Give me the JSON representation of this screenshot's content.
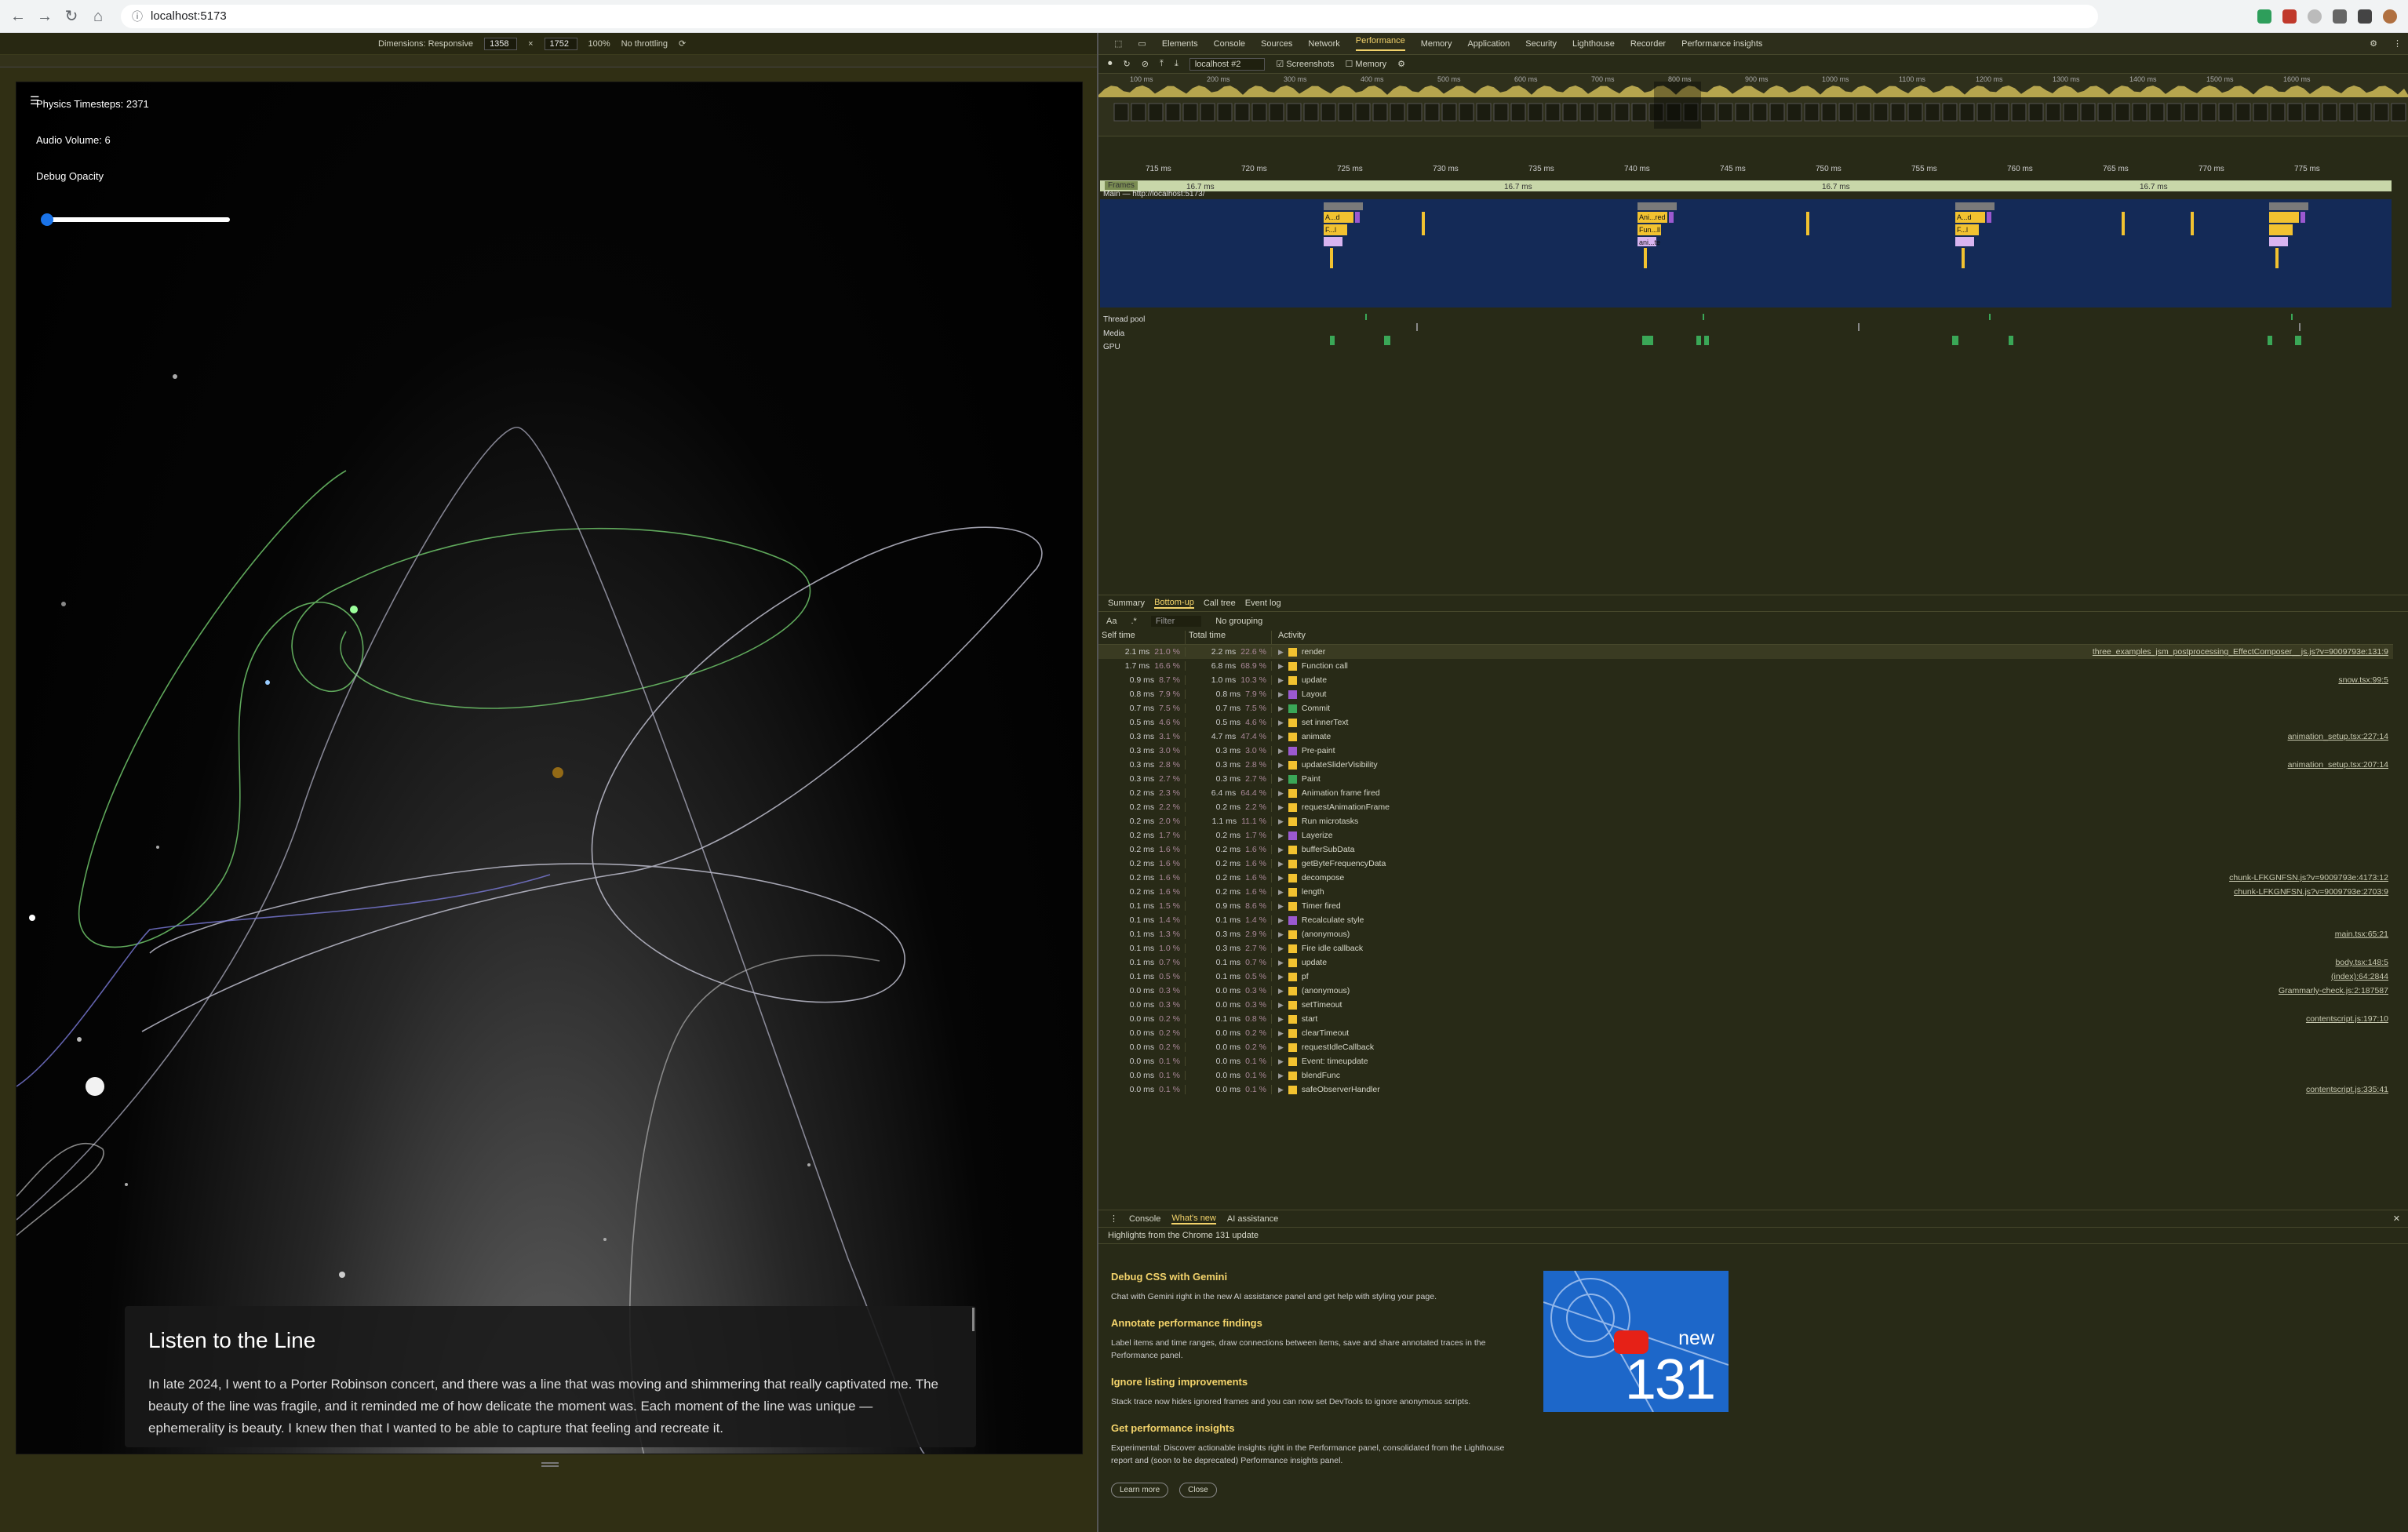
{
  "browser": {
    "url": "localhost:5173"
  },
  "emulation": {
    "dimensions_label": "Dimensions: Responsive",
    "width": "1358",
    "height": "1752",
    "zoom": "100%",
    "throttling": "No throttling"
  },
  "app": {
    "physics_timesteps": "Physics Timesteps: 2371",
    "audio_volume": "Audio Volume: 6",
    "debug_opacity_label": "Debug Opacity",
    "debug_opacity_value": 0.02,
    "card_title": "Listen to the Line",
    "card_text": "In late 2024, I went to a Porter Robinson concert, and there was a line that was moving and shimmering that really captivated me. The beauty of the line was fragile, and it reminded me of how delicate the moment was. Each moment of the line was unique — ephemerality is beauty. I knew then that I wanted to be able to capture that feeling and recreate it."
  },
  "devtools": {
    "tabs": [
      "Elements",
      "Console",
      "Sources",
      "Network",
      "Performance",
      "Memory",
      "Application",
      "Security",
      "Lighthouse",
      "Recorder",
      "Performance insights"
    ],
    "active_tab": "Performance",
    "recording_select": "localhost #2",
    "screenshots_label": "Screenshots",
    "memory_label": "Memory",
    "overview_ticks": [
      "100 ms",
      "200 ms",
      "300 ms",
      "400 ms",
      "500 ms",
      "600 ms",
      "700 ms",
      "800 ms",
      "900 ms",
      "1000 ms",
      "1100 ms",
      "1200 ms",
      "1300 ms",
      "1400 ms",
      "1500 ms",
      "1600 ms"
    ],
    "time_ticks": [
      "715 ms",
      "720 ms",
      "725 ms",
      "730 ms",
      "735 ms",
      "740 ms",
      "745 ms",
      "750 ms",
      "755 ms",
      "760 ms",
      "765 ms",
      "770 ms",
      "775 ms"
    ],
    "frames_label": "Frames",
    "frame_times": [
      "16.7 ms",
      "16.7 ms",
      "16.7 ms",
      "16.7 ms",
      "16.7 ms"
    ],
    "main_label": "Main — http://localhost:5173/",
    "flame_labels": [
      "A...d",
      "F...l",
      "Ani...red",
      "Fun...ll",
      "ani...te",
      "A...d",
      "F...l"
    ],
    "thread_pool_label": "Thread pool",
    "media_label": "Media",
    "gpu_label": "GPU",
    "sub_tabs": [
      "Summary",
      "Bottom-up",
      "Call tree",
      "Event log"
    ],
    "active_sub_tab": "Bottom-up",
    "filter_placeholder": "Filter",
    "grouping": "No grouping",
    "col_self": "Self time",
    "col_total": "Total time",
    "col_activity": "Activity",
    "rows": [
      {
        "self": "2.1 ms",
        "self_pct": "21.0 %",
        "total": "2.2 ms",
        "total_pct": "22.6 %",
        "name": "render",
        "color": "#f2c230",
        "link": "three_examples_jsm_postprocessing_EffectComposer__js.js?v=9009793e:131:9"
      },
      {
        "self": "1.7 ms",
        "self_pct": "16.6 %",
        "total": "6.8 ms",
        "total_pct": "68.9 %",
        "name": "Function call",
        "color": "#f2c230",
        "link": ""
      },
      {
        "self": "0.9 ms",
        "self_pct": "8.7 %",
        "total": "1.0 ms",
        "total_pct": "10.3 %",
        "name": "update",
        "color": "#f2c230",
        "link": "snow.tsx:99:5"
      },
      {
        "self": "0.8 ms",
        "self_pct": "7.9 %",
        "total": "0.8 ms",
        "total_pct": "7.9 %",
        "name": "Layout",
        "color": "#9b59d0",
        "link": ""
      },
      {
        "self": "0.7 ms",
        "self_pct": "7.5 %",
        "total": "0.7 ms",
        "total_pct": "7.5 %",
        "name": "Commit",
        "color": "#3aa757",
        "link": ""
      },
      {
        "self": "0.5 ms",
        "self_pct": "4.6 %",
        "total": "0.5 ms",
        "total_pct": "4.6 %",
        "name": "set innerText",
        "color": "#f2c230",
        "link": ""
      },
      {
        "self": "0.3 ms",
        "self_pct": "3.1 %",
        "total": "4.7 ms",
        "total_pct": "47.4 %",
        "name": "animate",
        "color": "#f2c230",
        "link": "animation_setup.tsx:227:14"
      },
      {
        "self": "0.3 ms",
        "self_pct": "3.0 %",
        "total": "0.3 ms",
        "total_pct": "3.0 %",
        "name": "Pre-paint",
        "color": "#9b59d0",
        "link": ""
      },
      {
        "self": "0.3 ms",
        "self_pct": "2.8 %",
        "total": "0.3 ms",
        "total_pct": "2.8 %",
        "name": "updateSliderVisibility",
        "color": "#f2c230",
        "link": "animation_setup.tsx:207:14"
      },
      {
        "self": "0.3 ms",
        "self_pct": "2.7 %",
        "total": "0.3 ms",
        "total_pct": "2.7 %",
        "name": "Paint",
        "color": "#3aa757",
        "link": ""
      },
      {
        "self": "0.2 ms",
        "self_pct": "2.3 %",
        "total": "6.4 ms",
        "total_pct": "64.4 %",
        "name": "Animation frame fired",
        "color": "#f2c230",
        "link": ""
      },
      {
        "self": "0.2 ms",
        "self_pct": "2.2 %",
        "total": "0.2 ms",
        "total_pct": "2.2 %",
        "name": "requestAnimationFrame",
        "color": "#f2c230",
        "link": ""
      },
      {
        "self": "0.2 ms",
        "self_pct": "2.0 %",
        "total": "1.1 ms",
        "total_pct": "11.1 %",
        "name": "Run microtasks",
        "color": "#f2c230",
        "link": ""
      },
      {
        "self": "0.2 ms",
        "self_pct": "1.7 %",
        "total": "0.2 ms",
        "total_pct": "1.7 %",
        "name": "Layerize",
        "color": "#9b59d0",
        "link": ""
      },
      {
        "self": "0.2 ms",
        "self_pct": "1.6 %",
        "total": "0.2 ms",
        "total_pct": "1.6 %",
        "name": "bufferSubData",
        "color": "#f2c230",
        "link": ""
      },
      {
        "self": "0.2 ms",
        "self_pct": "1.6 %",
        "total": "0.2 ms",
        "total_pct": "1.6 %",
        "name": "getByteFrequencyData",
        "color": "#f2c230",
        "link": ""
      },
      {
        "self": "0.2 ms",
        "self_pct": "1.6 %",
        "total": "0.2 ms",
        "total_pct": "1.6 %",
        "name": "decompose",
        "color": "#f2c230",
        "link": "chunk-LFKGNFSN.js?v=9009793e:4173:12"
      },
      {
        "self": "0.2 ms",
        "self_pct": "1.6 %",
        "total": "0.2 ms",
        "total_pct": "1.6 %",
        "name": "length",
        "color": "#f2c230",
        "link": "chunk-LFKGNFSN.js?v=9009793e:2703:9"
      },
      {
        "self": "0.1 ms",
        "self_pct": "1.5 %",
        "total": "0.9 ms",
        "total_pct": "8.6 %",
        "name": "Timer fired",
        "color": "#f2c230",
        "link": ""
      },
      {
        "self": "0.1 ms",
        "self_pct": "1.4 %",
        "total": "0.1 ms",
        "total_pct": "1.4 %",
        "name": "Recalculate style",
        "color": "#9b59d0",
        "link": ""
      },
      {
        "self": "0.1 ms",
        "self_pct": "1.3 %",
        "total": "0.3 ms",
        "total_pct": "2.9 %",
        "name": "(anonymous)",
        "color": "#f2c230",
        "link": "main.tsx:65:21"
      },
      {
        "self": "0.1 ms",
        "self_pct": "1.0 %",
        "total": "0.3 ms",
        "total_pct": "2.7 %",
        "name": "Fire idle callback",
        "color": "#f2c230",
        "link": ""
      },
      {
        "self": "0.1 ms",
        "self_pct": "0.7 %",
        "total": "0.1 ms",
        "total_pct": "0.7 %",
        "name": "update",
        "color": "#f2c230",
        "link": "body.tsx:148:5"
      },
      {
        "self": "0.1 ms",
        "self_pct": "0.5 %",
        "total": "0.1 ms",
        "total_pct": "0.5 %",
        "name": "pf",
        "color": "#f2c230",
        "link": "(index):64:2844"
      },
      {
        "self": "0.0 ms",
        "self_pct": "0.3 %",
        "total": "0.0 ms",
        "total_pct": "0.3 %",
        "name": "(anonymous)",
        "color": "#f2c230",
        "link": "Grammarly-check.js:2:187587"
      },
      {
        "self": "0.0 ms",
        "self_pct": "0.3 %",
        "total": "0.0 ms",
        "total_pct": "0.3 %",
        "name": "setTimeout",
        "color": "#f2c230",
        "link": ""
      },
      {
        "self": "0.0 ms",
        "self_pct": "0.2 %",
        "total": "0.1 ms",
        "total_pct": "0.8 %",
        "name": "start",
        "color": "#f2c230",
        "link": "contentscript.js:197:10"
      },
      {
        "self": "0.0 ms",
        "self_pct": "0.2 %",
        "total": "0.0 ms",
        "total_pct": "0.2 %",
        "name": "clearTimeout",
        "color": "#f2c230",
        "link": ""
      },
      {
        "self": "0.0 ms",
        "self_pct": "0.2 %",
        "total": "0.0 ms",
        "total_pct": "0.2 %",
        "name": "requestIdleCallback",
        "color": "#f2c230",
        "link": ""
      },
      {
        "self": "0.0 ms",
        "self_pct": "0.1 %",
        "total": "0.0 ms",
        "total_pct": "0.1 %",
        "name": "Event: timeupdate",
        "color": "#f2c230",
        "link": ""
      },
      {
        "self": "0.0 ms",
        "self_pct": "0.1 %",
        "total": "0.0 ms",
        "total_pct": "0.1 %",
        "name": "blendFunc",
        "color": "#f2c230",
        "link": ""
      },
      {
        "self": "0.0 ms",
        "self_pct": "0.1 %",
        "total": "0.0 ms",
        "total_pct": "0.1 %",
        "name": "safeObserverHandler",
        "color": "#f2c230",
        "link": "contentscript.js:335:41"
      }
    ],
    "drawer": {
      "tabs": [
        "Console",
        "What's new",
        "AI assistance"
      ],
      "active": "What's new",
      "subtitle": "Highlights from the Chrome 131 update",
      "items": [
        {
          "h": "Debug CSS with Gemini",
          "t": "Chat with Gemini right in the new AI assistance panel and get help with styling your page."
        },
        {
          "h": "Annotate performance findings",
          "t": "Label items and time ranges, draw connections between items, save and share annotated traces in the Performance panel."
        },
        {
          "h": "Ignore listing improvements",
          "t": "Stack trace now hides ignored frames and you can now set DevTools to ignore anonymous scripts."
        },
        {
          "h": "Get performance insights",
          "t": "Experimental: Discover actionable insights right in the Performance panel, consolidated from the Lighthouse report and (soon to be deprecated) Performance insights panel."
        }
      ],
      "badge_new": "new",
      "badge_version": "131",
      "learn_more": "Learn more",
      "close": "Close"
    }
  }
}
